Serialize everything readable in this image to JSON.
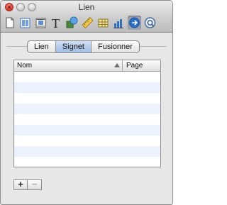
{
  "window": {
    "title": "Lien"
  },
  "toolbar": {
    "items": [
      {
        "name": "document-inspector",
        "icon": "document-icon"
      },
      {
        "name": "layout-inspector",
        "icon": "layout-icon"
      },
      {
        "name": "wrap-inspector",
        "icon": "wrap-icon"
      },
      {
        "name": "text-inspector",
        "icon": "text-T-icon",
        "glyph": "T"
      },
      {
        "name": "graphic-inspector",
        "icon": "shapes-icon"
      },
      {
        "name": "metrics-inspector",
        "icon": "ruler-icon"
      },
      {
        "name": "table-inspector",
        "icon": "table-icon"
      },
      {
        "name": "chart-inspector",
        "icon": "bar-chart-icon"
      },
      {
        "name": "link-inspector",
        "icon": "link-arrow-icon",
        "active": true
      },
      {
        "name": "quicktime-inspector",
        "icon": "quicktime-icon"
      }
    ]
  },
  "tabs": [
    {
      "label": "Lien",
      "selected": false
    },
    {
      "label": "Signet",
      "selected": true
    },
    {
      "label": "Fusionner",
      "selected": false
    }
  ],
  "table": {
    "columns": [
      {
        "label": "Nom",
        "sort": "ascending"
      },
      {
        "label": "Page"
      }
    ],
    "empty_rows": 9
  },
  "footer": {
    "add_label": "+",
    "remove_label": "−"
  },
  "colors": {
    "selection": "#9ebde4",
    "stripe": "#edf3fe",
    "accent": "#2a6fc9"
  }
}
